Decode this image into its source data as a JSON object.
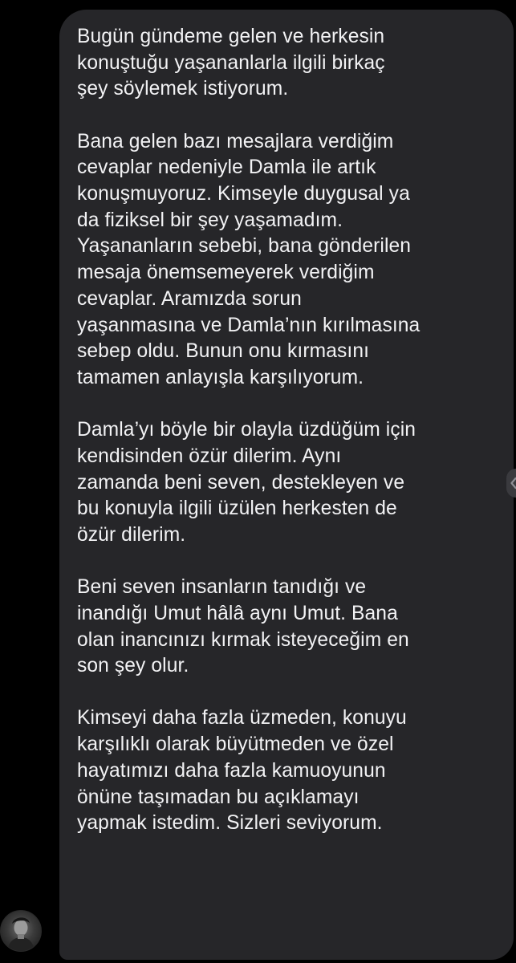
{
  "conversation": {
    "message": {
      "paragraphs": [
        "Bugün gündeme gelen ve herkesin\nkonuştuğu yaşananlarla ilgili birkaç\nşey söylemek istiyorum.",
        "Bana gelen bazı mesajlara verdiğim\ncevaplar nedeniyle Damla ile artık\nkonuşmuyoruz. Kimseyle duygusal ya\nda fiziksel bir şey yaşamadım.\nYaşananların sebebi, bana gönderilen\nmesaja önemsemeyerek verdiğim\ncevaplar. Aramızda sorun\nyaşanmasına ve Damla’nın kırılmasına\nsebep oldu. Bunun onu kırmasını\ntamamen anlayışla karşılıyorum.",
        "Damla’yı böyle bir olayla üzdüğüm için\nkendisinden özür dilerim. Aynı\nzamanda beni seven, destekleyen ve\nbu konuyla ilgili üzülen herkesten de\nözür dilerim.",
        "Beni seven insanların tanıdığı ve\ninandığı Umut hâlâ aynı Umut. Bana\nolan inancınızı kırmak isteyeceğim en\nson şey olur.",
        "Kimseyi daha fazla üzmeden, konuyu\nkarşılıklı olarak büyütmeden ve özel\nhayatımızı daha fazla kamuoyunun\nönüne taşımadan bu açıklamayı\nyapmak istedim. Sizleri seviyorum."
      ]
    },
    "colors": {
      "background": "#000000",
      "bubble": "#262629",
      "text": "#f2f2f4"
    },
    "icons": {
      "avatar": "sender-avatar",
      "reaction": "chevron-left-icon"
    }
  }
}
